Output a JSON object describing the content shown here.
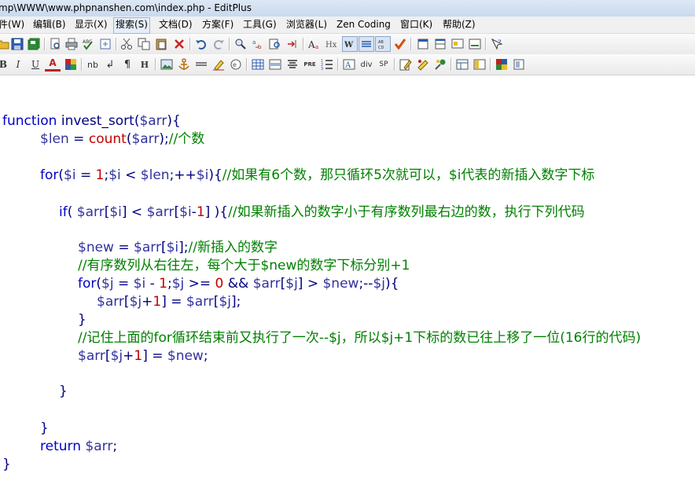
{
  "window": {
    "title": "mp\\WWW\\www.phpnanshen.com\\index.php - EditPlus"
  },
  "menu": {
    "items": [
      "件(W)",
      "编辑(B)",
      "显示(X)",
      "搜索(S)",
      "文档(D)",
      "方案(F)",
      "工具(G)",
      "浏览器(L)",
      "Zen Coding",
      "窗口(K)",
      "帮助(Z)"
    ]
  },
  "toolbar2": {
    "labels": {
      "bold": "B",
      "italic": "I",
      "underline": "U",
      "font_color": "A",
      "nbsp": "nb",
      "br": "↲",
      "paragraph": "¶",
      "heading": "H",
      "pre": "PRE",
      "div": "div",
      "span": "SP",
      "hx": "Hx"
    }
  },
  "editor": {
    "lines": [
      {
        "tokens": [
          {
            "t": "function ",
            "c": "kw"
          },
          {
            "t": "invest_sort",
            "c": "txt"
          },
          {
            "t": "(",
            "c": "op"
          },
          {
            "t": "$arr",
            "c": "var"
          },
          {
            "t": "){",
            "c": "op"
          }
        ]
      },
      {
        "tokens": [
          {
            "t": "$len",
            "c": "var"
          },
          {
            "t": " = ",
            "c": "op"
          },
          {
            "t": "count",
            "c": "fn"
          },
          {
            "t": "(",
            "c": "op"
          },
          {
            "t": "$arr",
            "c": "var"
          },
          {
            "t": ");",
            "c": "op"
          },
          {
            "t": "//个数",
            "c": "cmt"
          }
        ]
      },
      {
        "tokens": [
          {
            "t": "for",
            "c": "kw"
          },
          {
            "t": "(",
            "c": "op"
          },
          {
            "t": "$i",
            "c": "var"
          },
          {
            "t": " = ",
            "c": "op"
          },
          {
            "t": "1",
            "c": "num"
          },
          {
            "t": ";",
            "c": "op"
          },
          {
            "t": "$i",
            "c": "var"
          },
          {
            "t": " < ",
            "c": "op"
          },
          {
            "t": "$len",
            "c": "var"
          },
          {
            "t": ";++",
            "c": "op"
          },
          {
            "t": "$i",
            "c": "var"
          },
          {
            "t": "){",
            "c": "op"
          },
          {
            "t": "//如果有6个数，那只循环5次就可以，$i代表的新插入数字下标",
            "c": "cmt"
          }
        ]
      },
      {
        "tokens": [
          {
            "t": "if",
            "c": "kw"
          },
          {
            "t": "( ",
            "c": "op"
          },
          {
            "t": "$arr",
            "c": "var"
          },
          {
            "t": "[",
            "c": "op"
          },
          {
            "t": "$i",
            "c": "var"
          },
          {
            "t": "] < ",
            "c": "op"
          },
          {
            "t": "$arr",
            "c": "var"
          },
          {
            "t": "[",
            "c": "op"
          },
          {
            "t": "$i",
            "c": "var"
          },
          {
            "t": "-",
            "c": "op"
          },
          {
            "t": "1",
            "c": "num"
          },
          {
            "t": "] ){",
            "c": "op"
          },
          {
            "t": "//如果新插入的数字小于有序数列最右边的数，执行下列代码",
            "c": "cmt"
          }
        ]
      },
      {
        "tokens": [
          {
            "t": "$new",
            "c": "var"
          },
          {
            "t": " = ",
            "c": "op"
          },
          {
            "t": "$arr",
            "c": "var"
          },
          {
            "t": "[",
            "c": "op"
          },
          {
            "t": "$i",
            "c": "var"
          },
          {
            "t": "];",
            "c": "op"
          },
          {
            "t": "//新插入的数字",
            "c": "cmt"
          }
        ]
      },
      {
        "tokens": [
          {
            "t": "//有序数列从右往左，每个大于$new的数字下标分别+1",
            "c": "cmt"
          }
        ]
      },
      {
        "tokens": [
          {
            "t": "for",
            "c": "kw"
          },
          {
            "t": "(",
            "c": "op"
          },
          {
            "t": "$j",
            "c": "var"
          },
          {
            "t": " = ",
            "c": "op"
          },
          {
            "t": "$i",
            "c": "var"
          },
          {
            "t": " - ",
            "c": "op"
          },
          {
            "t": "1",
            "c": "num"
          },
          {
            "t": ";",
            "c": "op"
          },
          {
            "t": "$j",
            "c": "var"
          },
          {
            "t": " >= ",
            "c": "op"
          },
          {
            "t": "0",
            "c": "num"
          },
          {
            "t": " && ",
            "c": "op"
          },
          {
            "t": "$arr",
            "c": "var"
          },
          {
            "t": "[",
            "c": "op"
          },
          {
            "t": "$j",
            "c": "var"
          },
          {
            "t": "] > ",
            "c": "op"
          },
          {
            "t": "$new",
            "c": "var"
          },
          {
            "t": ";--",
            "c": "op"
          },
          {
            "t": "$j",
            "c": "var"
          },
          {
            "t": "){",
            "c": "op"
          }
        ]
      },
      {
        "tokens": [
          {
            "t": "$arr",
            "c": "var"
          },
          {
            "t": "[",
            "c": "op"
          },
          {
            "t": "$j",
            "c": "var"
          },
          {
            "t": "+",
            "c": "op"
          },
          {
            "t": "1",
            "c": "num"
          },
          {
            "t": "] = ",
            "c": "op"
          },
          {
            "t": "$arr",
            "c": "var"
          },
          {
            "t": "[",
            "c": "op"
          },
          {
            "t": "$j",
            "c": "var"
          },
          {
            "t": "];",
            "c": "op"
          }
        ]
      },
      {
        "tokens": [
          {
            "t": "}",
            "c": "op"
          }
        ]
      },
      {
        "tokens": [
          {
            "t": "//记住上面的for循环结束前又执行了一次--$j，所以$j+1下标的数已往上移了一位(16行的代码)",
            "c": "cmt"
          }
        ]
      },
      {
        "tokens": [
          {
            "t": "$arr",
            "c": "var"
          },
          {
            "t": "[",
            "c": "op"
          },
          {
            "t": "$j",
            "c": "var"
          },
          {
            "t": "+",
            "c": "op"
          },
          {
            "t": "1",
            "c": "num"
          },
          {
            "t": "] = ",
            "c": "op"
          },
          {
            "t": "$new",
            "c": "var"
          },
          {
            "t": ";",
            "c": "op"
          }
        ]
      },
      {
        "tokens": [
          {
            "t": "}",
            "c": "op"
          }
        ]
      },
      {
        "tokens": [
          {
            "t": "}",
            "c": "op"
          }
        ]
      },
      {
        "tokens": [
          {
            "t": "return ",
            "c": "kw"
          },
          {
            "t": "$arr",
            "c": "var"
          },
          {
            "t": ";",
            "c": "op"
          }
        ]
      },
      {
        "tokens": [
          {
            "t": "}",
            "c": "op"
          }
        ]
      }
    ]
  }
}
